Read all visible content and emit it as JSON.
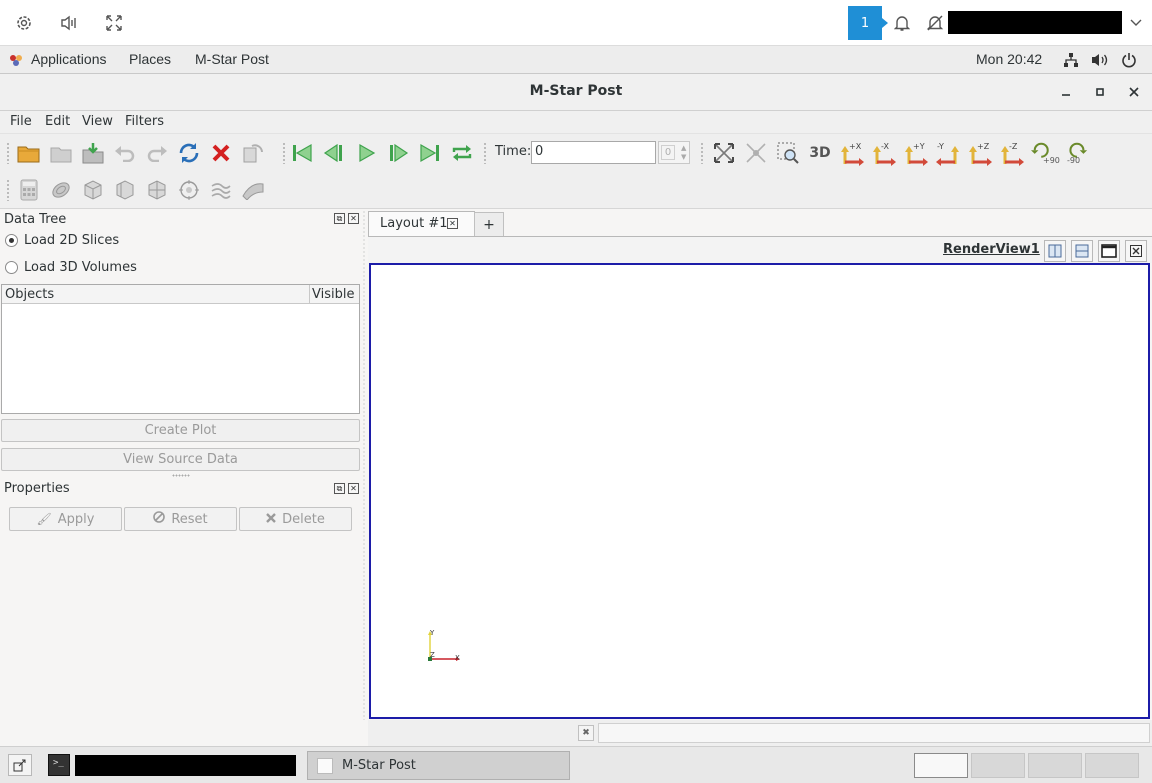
{
  "vnc_bar": {
    "icons": [
      "settings-icon",
      "audio-icon",
      "fullscreen-icon",
      "bell-icon",
      "user-icon",
      "chevron-down-icon"
    ],
    "notification_count": "1"
  },
  "gnome_panel": {
    "applications": "Applications",
    "places": "Places",
    "app_name": "M-Star Post",
    "clock": "Mon 20:42"
  },
  "window": {
    "title": "M-Star Post"
  },
  "menubar": {
    "file": "File",
    "edit": "Edit",
    "view": "View",
    "filters": "Filters"
  },
  "toolbar": {
    "time_label": "Time:",
    "time_value": "0",
    "time_index": "0",
    "view_3d": "3D",
    "axis_buttons": [
      "+X",
      "-X",
      "+Y",
      "-Y",
      "+Z",
      "-Z"
    ],
    "rotate_plus": "+90",
    "rotate_minus": "-90"
  },
  "data_tree": {
    "title": "Data Tree",
    "option_2d": "Load 2D Slices",
    "option_3d": "Load 3D Volumes",
    "selected": "Load 2D Slices",
    "col_objects": "Objects",
    "col_visible": "Visible",
    "create_plot": "Create Plot",
    "view_source": "View Source Data"
  },
  "properties": {
    "title": "Properties",
    "apply": "Apply",
    "reset": "Reset",
    "delete": "Delete"
  },
  "layout": {
    "tab_label": "Layout #1",
    "add_tab": "+",
    "view_name": "RenderView1"
  },
  "axes_widget": {
    "y": "Y",
    "z": "Z",
    "x": "X"
  },
  "taskbar": {
    "window_label": "M-Star Post"
  },
  "colors": {
    "accent_blue": "#1f8fd6",
    "render_border": "#1c1ca8",
    "delete_red": "#d42020",
    "play_green": "#3fa34d"
  }
}
